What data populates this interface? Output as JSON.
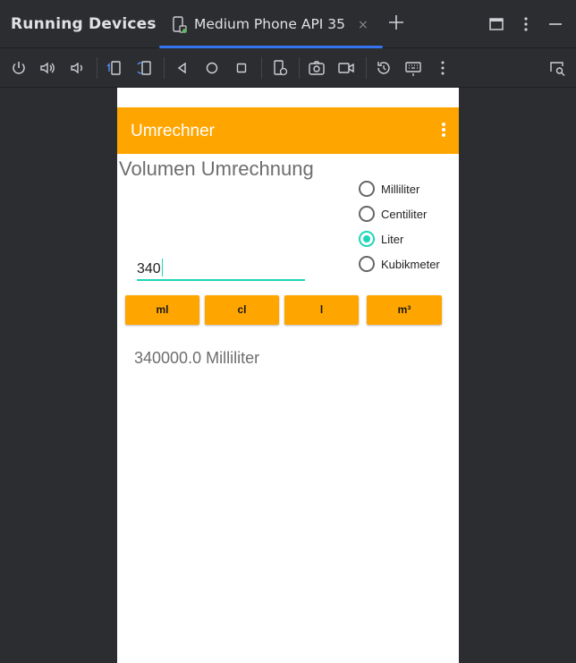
{
  "ide": {
    "panel_title": "Running Devices",
    "tab_label": "Medium Phone API 35",
    "tab_close": "×"
  },
  "toolbar": {
    "icons": [
      "power-icon",
      "volume-up-icon",
      "volume-down-icon",
      "rotate-left-icon",
      "rotate-right-icon",
      "back-icon",
      "home-icon",
      "overview-icon",
      "device-settings-icon",
      "screenshot-icon",
      "screen-record-icon",
      "reset-icon",
      "keyboard-icon",
      "more-icon",
      "device-mirror-icon"
    ]
  },
  "app": {
    "title": "Umrechner",
    "heading": "Volumen Umrechnung",
    "radios": [
      {
        "label": "Milliliter",
        "checked": false
      },
      {
        "label": "Centiliter",
        "checked": false
      },
      {
        "label": "Liter",
        "checked": true
      },
      {
        "label": "Kubikmeter",
        "checked": false
      }
    ],
    "input_value": "340",
    "buttons": [
      "ml",
      "cl",
      "l",
      "m³"
    ],
    "result": "340000.0 Milliliter"
  },
  "colors": {
    "accent": "#ffa500",
    "radio_active": "#1dd6b8",
    "tab_highlight": "#3574f0",
    "ide_bg": "#2b2d30"
  }
}
